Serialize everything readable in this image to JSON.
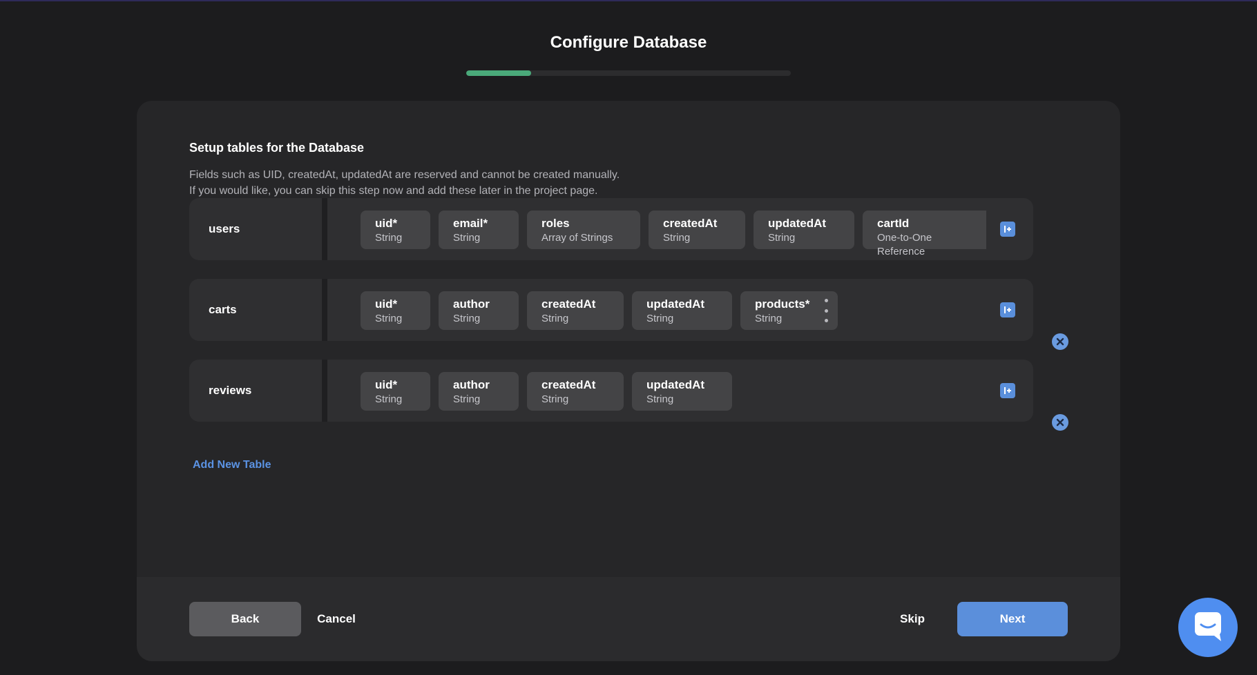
{
  "page": {
    "title": "Configure Database",
    "progress_fraction": 0.2
  },
  "setup": {
    "title": "Setup tables for the Database",
    "description_line1": "Fields such as UID, createdAt, updatedAt are reserved and cannot be created manually.",
    "description_line2": "If you would like, you can skip this step now and add these later in the project page."
  },
  "tables": [
    {
      "name": "users",
      "fields": [
        {
          "name": "uid*",
          "type": "String"
        },
        {
          "name": "email*",
          "type": "String"
        },
        {
          "name": "roles",
          "type": "Array of Strings"
        },
        {
          "name": "createdAt",
          "type": "String"
        },
        {
          "name": "updatedAt",
          "type": "String"
        },
        {
          "name": "cartId",
          "type": "One-to-One Reference"
        }
      ]
    },
    {
      "name": "carts",
      "fields": [
        {
          "name": "uid*",
          "type": "String"
        },
        {
          "name": "author",
          "type": "String"
        },
        {
          "name": "createdAt",
          "type": "String"
        },
        {
          "name": "updatedAt",
          "type": "String"
        },
        {
          "name": "products*",
          "type": "String"
        }
      ]
    },
    {
      "name": "reviews",
      "fields": [
        {
          "name": "uid*",
          "type": "String"
        },
        {
          "name": "author",
          "type": "String"
        },
        {
          "name": "createdAt",
          "type": "String"
        },
        {
          "name": "updatedAt",
          "type": "String"
        }
      ]
    }
  ],
  "actions": {
    "add_table": "Add New Table",
    "back": "Back",
    "cancel": "Cancel",
    "skip": "Skip",
    "next": "Next"
  },
  "colors": {
    "accent": "#5b8fdb",
    "progress": "#4aa97a",
    "chat": "#4f8ef0"
  },
  "icons": {
    "add_field": "add-column-icon",
    "remove_table": "close-circle-icon",
    "field_menu": "more-vertical-icon",
    "chat": "chat-bubble-icon"
  }
}
